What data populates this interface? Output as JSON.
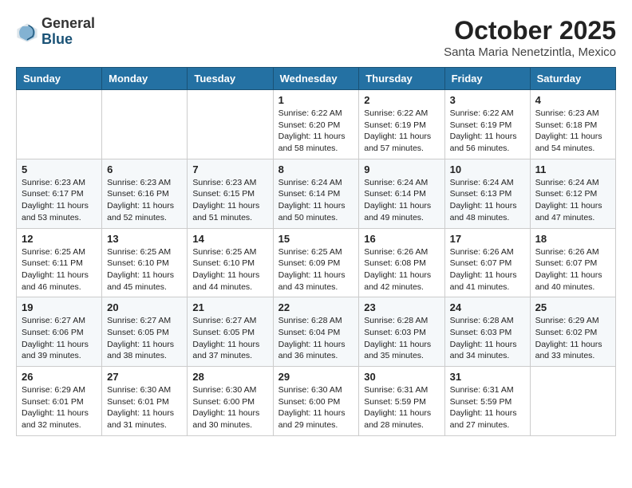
{
  "header": {
    "logo_general": "General",
    "logo_blue": "Blue",
    "month": "October 2025",
    "location": "Santa Maria Nenetzintla, Mexico"
  },
  "days_of_week": [
    "Sunday",
    "Monday",
    "Tuesday",
    "Wednesday",
    "Thursday",
    "Friday",
    "Saturday"
  ],
  "weeks": [
    [
      {
        "day": "",
        "info": ""
      },
      {
        "day": "",
        "info": ""
      },
      {
        "day": "",
        "info": ""
      },
      {
        "day": "1",
        "info": "Sunrise: 6:22 AM\nSunset: 6:20 PM\nDaylight: 11 hours and 58 minutes."
      },
      {
        "day": "2",
        "info": "Sunrise: 6:22 AM\nSunset: 6:19 PM\nDaylight: 11 hours and 57 minutes."
      },
      {
        "day": "3",
        "info": "Sunrise: 6:22 AM\nSunset: 6:19 PM\nDaylight: 11 hours and 56 minutes."
      },
      {
        "day": "4",
        "info": "Sunrise: 6:23 AM\nSunset: 6:18 PM\nDaylight: 11 hours and 54 minutes."
      }
    ],
    [
      {
        "day": "5",
        "info": "Sunrise: 6:23 AM\nSunset: 6:17 PM\nDaylight: 11 hours and 53 minutes."
      },
      {
        "day": "6",
        "info": "Sunrise: 6:23 AM\nSunset: 6:16 PM\nDaylight: 11 hours and 52 minutes."
      },
      {
        "day": "7",
        "info": "Sunrise: 6:23 AM\nSunset: 6:15 PM\nDaylight: 11 hours and 51 minutes."
      },
      {
        "day": "8",
        "info": "Sunrise: 6:24 AM\nSunset: 6:14 PM\nDaylight: 11 hours and 50 minutes."
      },
      {
        "day": "9",
        "info": "Sunrise: 6:24 AM\nSunset: 6:14 PM\nDaylight: 11 hours and 49 minutes."
      },
      {
        "day": "10",
        "info": "Sunrise: 6:24 AM\nSunset: 6:13 PM\nDaylight: 11 hours and 48 minutes."
      },
      {
        "day": "11",
        "info": "Sunrise: 6:24 AM\nSunset: 6:12 PM\nDaylight: 11 hours and 47 minutes."
      }
    ],
    [
      {
        "day": "12",
        "info": "Sunrise: 6:25 AM\nSunset: 6:11 PM\nDaylight: 11 hours and 46 minutes."
      },
      {
        "day": "13",
        "info": "Sunrise: 6:25 AM\nSunset: 6:10 PM\nDaylight: 11 hours and 45 minutes."
      },
      {
        "day": "14",
        "info": "Sunrise: 6:25 AM\nSunset: 6:10 PM\nDaylight: 11 hours and 44 minutes."
      },
      {
        "day": "15",
        "info": "Sunrise: 6:25 AM\nSunset: 6:09 PM\nDaylight: 11 hours and 43 minutes."
      },
      {
        "day": "16",
        "info": "Sunrise: 6:26 AM\nSunset: 6:08 PM\nDaylight: 11 hours and 42 minutes."
      },
      {
        "day": "17",
        "info": "Sunrise: 6:26 AM\nSunset: 6:07 PM\nDaylight: 11 hours and 41 minutes."
      },
      {
        "day": "18",
        "info": "Sunrise: 6:26 AM\nSunset: 6:07 PM\nDaylight: 11 hours and 40 minutes."
      }
    ],
    [
      {
        "day": "19",
        "info": "Sunrise: 6:27 AM\nSunset: 6:06 PM\nDaylight: 11 hours and 39 minutes."
      },
      {
        "day": "20",
        "info": "Sunrise: 6:27 AM\nSunset: 6:05 PM\nDaylight: 11 hours and 38 minutes."
      },
      {
        "day": "21",
        "info": "Sunrise: 6:27 AM\nSunset: 6:05 PM\nDaylight: 11 hours and 37 minutes."
      },
      {
        "day": "22",
        "info": "Sunrise: 6:28 AM\nSunset: 6:04 PM\nDaylight: 11 hours and 36 minutes."
      },
      {
        "day": "23",
        "info": "Sunrise: 6:28 AM\nSunset: 6:03 PM\nDaylight: 11 hours and 35 minutes."
      },
      {
        "day": "24",
        "info": "Sunrise: 6:28 AM\nSunset: 6:03 PM\nDaylight: 11 hours and 34 minutes."
      },
      {
        "day": "25",
        "info": "Sunrise: 6:29 AM\nSunset: 6:02 PM\nDaylight: 11 hours and 33 minutes."
      }
    ],
    [
      {
        "day": "26",
        "info": "Sunrise: 6:29 AM\nSunset: 6:01 PM\nDaylight: 11 hours and 32 minutes."
      },
      {
        "day": "27",
        "info": "Sunrise: 6:30 AM\nSunset: 6:01 PM\nDaylight: 11 hours and 31 minutes."
      },
      {
        "day": "28",
        "info": "Sunrise: 6:30 AM\nSunset: 6:00 PM\nDaylight: 11 hours and 30 minutes."
      },
      {
        "day": "29",
        "info": "Sunrise: 6:30 AM\nSunset: 6:00 PM\nDaylight: 11 hours and 29 minutes."
      },
      {
        "day": "30",
        "info": "Sunrise: 6:31 AM\nSunset: 5:59 PM\nDaylight: 11 hours and 28 minutes."
      },
      {
        "day": "31",
        "info": "Sunrise: 6:31 AM\nSunset: 5:59 PM\nDaylight: 11 hours and 27 minutes."
      },
      {
        "day": "",
        "info": ""
      }
    ]
  ]
}
